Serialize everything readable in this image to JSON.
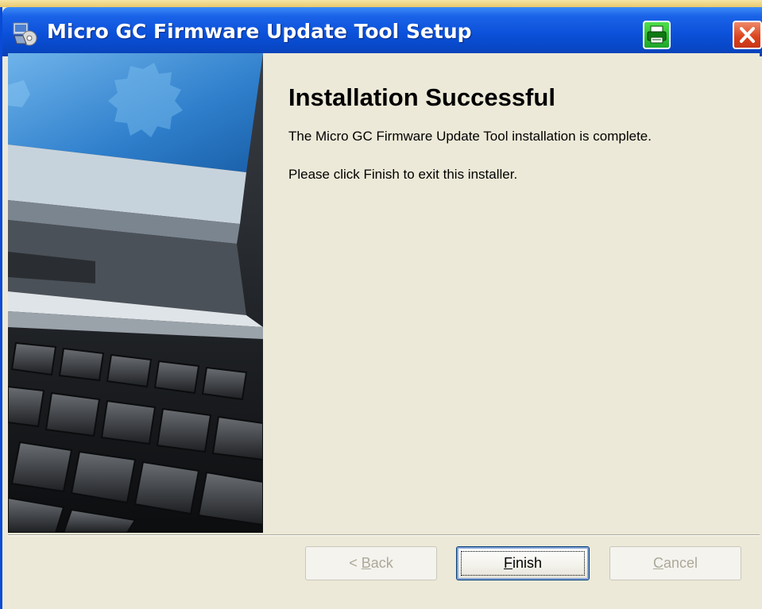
{
  "window": {
    "title": "Micro GC Firmware Update Tool Setup",
    "title_bar_color": "#0b50d9"
  },
  "icons": {
    "app": "installer-icon",
    "printer": "printer-icon",
    "close": "close-icon"
  },
  "content": {
    "heading": "Installation Successful",
    "message": "The Micro GC Firmware Update Tool installation is complete.",
    "instruction": "Please click Finish to exit this installer."
  },
  "buttons": {
    "back": {
      "prefix": "< ",
      "mnemonic": "B",
      "rest": "ack",
      "enabled": false
    },
    "finish": {
      "prefix": "",
      "mnemonic": "F",
      "rest": "inish",
      "enabled": true
    },
    "cancel": {
      "prefix": "",
      "mnemonic": "C",
      "rest": "ancel",
      "enabled": false
    }
  }
}
